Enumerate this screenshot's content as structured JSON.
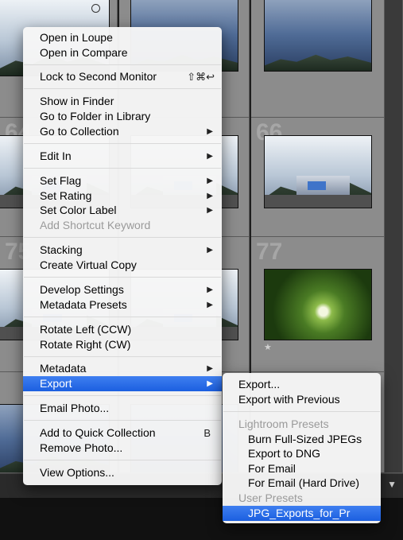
{
  "grid": {
    "cell_numbers": [
      "64",
      "66",
      "75",
      "77"
    ]
  },
  "context_menu": {
    "items": [
      {
        "label": "Open in Loupe"
      },
      {
        "label": "Open in Compare"
      },
      {
        "label": "Lock to Second Monitor",
        "shortcut": "⇧⌘↩"
      },
      {
        "label": "Show in Finder"
      },
      {
        "label": "Go to Folder in Library"
      },
      {
        "label": "Go to Collection",
        "submenu": true
      },
      {
        "label": "Edit In",
        "submenu": true
      },
      {
        "label": "Set Flag",
        "submenu": true
      },
      {
        "label": "Set Rating",
        "submenu": true
      },
      {
        "label": "Set Color Label",
        "submenu": true
      },
      {
        "label": "Add Shortcut Keyword",
        "disabled": true
      },
      {
        "label": "Stacking",
        "submenu": true
      },
      {
        "label": "Create Virtual Copy"
      },
      {
        "label": "Develop Settings",
        "submenu": true
      },
      {
        "label": "Metadata Presets",
        "submenu": true
      },
      {
        "label": "Rotate Left (CCW)"
      },
      {
        "label": "Rotate Right (CW)"
      },
      {
        "label": "Metadata",
        "submenu": true
      },
      {
        "label": "Export",
        "submenu": true,
        "highlighted": true
      },
      {
        "label": "Email Photo..."
      },
      {
        "label": "Add to Quick Collection",
        "shortcut": "B"
      },
      {
        "label": "Remove Photo..."
      },
      {
        "label": "View Options..."
      }
    ],
    "arrow_glyph": "▶"
  },
  "export_submenu": {
    "items": [
      {
        "label": "Export..."
      },
      {
        "label": "Export with Previous"
      },
      {
        "label": "Lightroom Presets",
        "heading": true
      },
      {
        "label": "Burn Full-Sized JPEGs"
      },
      {
        "label": "Export to DNG"
      },
      {
        "label": "For Email"
      },
      {
        "label": "For Email (Hard Drive)"
      },
      {
        "label": "User Presets",
        "heading": true
      },
      {
        "label": "JPG_Exports_for_Pr",
        "highlighted": true
      }
    ]
  },
  "filmstrip": {
    "toggle_glyph": "▼"
  },
  "colors": {
    "highlight": "#2a6ce8",
    "disabled_text": "#9a9a9a"
  }
}
